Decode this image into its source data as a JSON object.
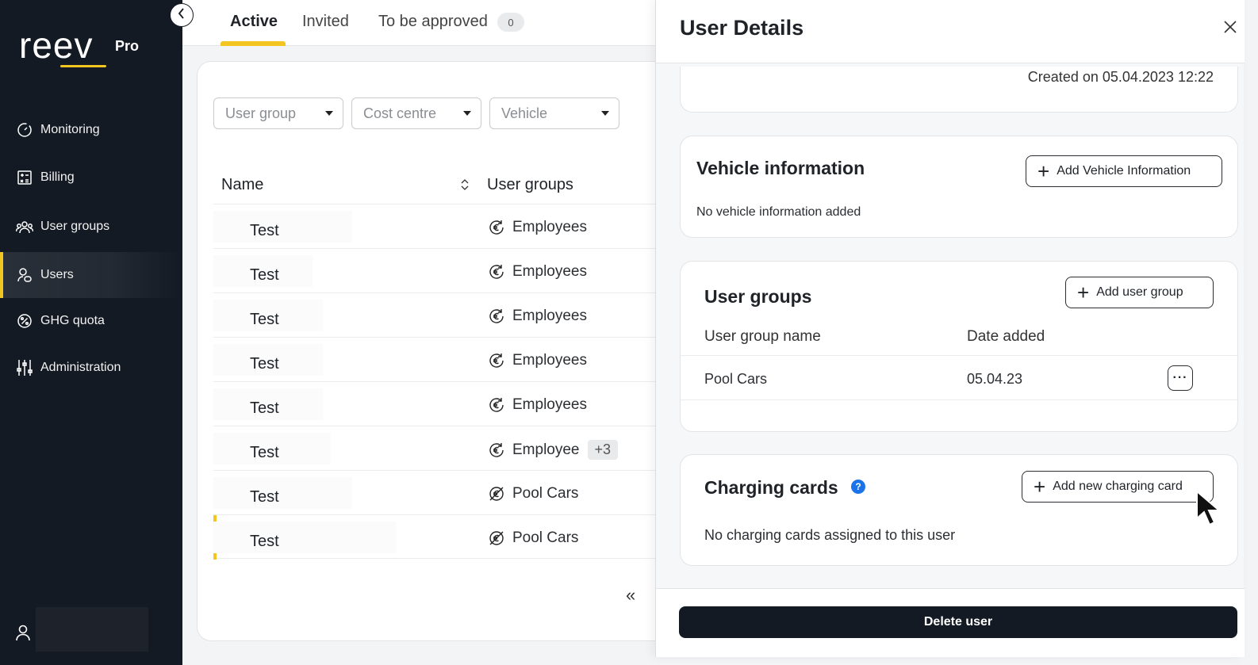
{
  "brand": {
    "logo_text": "reev",
    "edition": "Pro",
    "accent_color": "#f3c520"
  },
  "sidebar": {
    "items": [
      {
        "label": "Monitoring",
        "icon": "gauge-icon"
      },
      {
        "label": "Billing",
        "icon": "calculator-icon"
      },
      {
        "label": "User groups",
        "icon": "group-icon"
      },
      {
        "label": "Users",
        "icon": "users-icon",
        "active": true
      },
      {
        "label": "GHG quota",
        "icon": "percent-icon"
      },
      {
        "label": "Administration",
        "icon": "sliders-icon"
      }
    ]
  },
  "tabs": [
    {
      "label": "Active",
      "active": true
    },
    {
      "label": "Invited"
    },
    {
      "label": "To be approved",
      "badge": "0"
    }
  ],
  "filters": [
    {
      "placeholder": "User group"
    },
    {
      "placeholder": "Cost centre"
    },
    {
      "placeholder": "Vehicle"
    }
  ],
  "table": {
    "headers": [
      "Name",
      "User groups"
    ],
    "rows": [
      {
        "name": "Test",
        "group": "Employees",
        "icon": "euro-cycle-icon"
      },
      {
        "name": "Test",
        "group": "Employees",
        "icon": "euro-cycle-icon"
      },
      {
        "name": "Test",
        "group": "Employees",
        "icon": "euro-cycle-icon"
      },
      {
        "name": "Test",
        "group": "Employees",
        "icon": "euro-cycle-icon"
      },
      {
        "name": "Test",
        "group": "Employees",
        "icon": "euro-cycle-icon"
      },
      {
        "name": "Test",
        "group": "Employee",
        "extra": "+3",
        "icon": "euro-cycle-icon"
      },
      {
        "name": "Test",
        "group": "Pool Cars",
        "icon": "euro-off-icon"
      },
      {
        "name": "Test",
        "group": "Pool Cars",
        "icon": "euro-off-icon",
        "selected": true
      }
    ],
    "pager_label": "«"
  },
  "panel": {
    "title": "User Details",
    "created_text": "Created on 05.04.2023 12:22",
    "vehicle": {
      "title": "Vehicle information",
      "button": "Add Vehicle Information",
      "empty": "No vehicle information added"
    },
    "user_groups": {
      "title": "User groups",
      "button": "Add user group",
      "col_name": "User group name",
      "col_date": "Date added",
      "rows": [
        {
          "name": "Pool Cars",
          "date": "05.04.23"
        }
      ]
    },
    "charging_cards": {
      "title": "Charging cards",
      "button": "Add new charging card",
      "empty": "No charging cards assigned to this user"
    },
    "delete_button": "Delete user"
  }
}
